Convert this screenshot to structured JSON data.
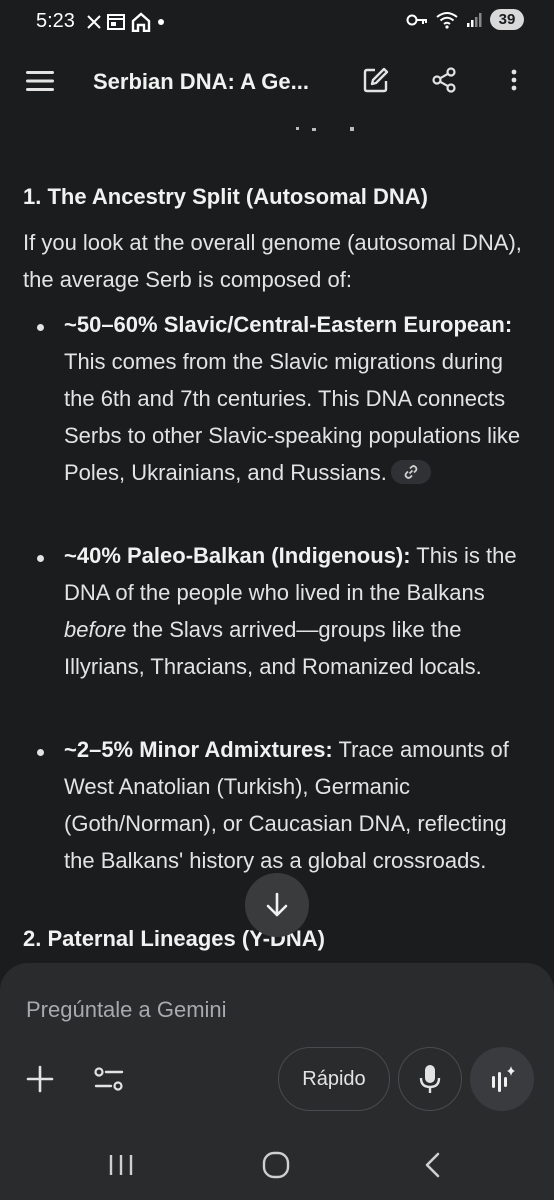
{
  "status_bar": {
    "time": "5:23",
    "battery": "39",
    "icons": [
      "x-icon",
      "calendar-icon",
      "home-icon",
      "dot-icon",
      "key-icon",
      "wifi-icon",
      "signal-icon"
    ]
  },
  "app_bar": {
    "title": "Serbian DNA: A Ge...",
    "icons": [
      "menu-icon",
      "edit-icon",
      "share-icon",
      "more-vert-icon"
    ]
  },
  "content": {
    "section1_heading": "1. The Ancestry Split (Autosomal DNA)",
    "intro": "If you look at the overall genome (autosomal DNA), the average Serb is composed of:",
    "bullets": [
      {
        "bold": "~50–60% Slavic/Central-Eastern European:",
        "text": " This comes from the Slavic migrations during the 6th and 7th centuries. This DNA connects Serbs to other Slavic-speaking populations like Poles, Ukrainians, and Russians."
      },
      {
        "bold": "~40% Paleo-Balkan (Indigenous):",
        "text_before": " This is the DNA of the people who lived in the Balkans ",
        "italic": "before",
        "text_after": " the Slavs arrived—groups like the Illyrians, Thracians, and Romanized locals."
      },
      {
        "bold": "~2–5% Minor Admixtures:",
        "text": " Trace amounts of West Anatolian (Turkish), Germanic (Goth/Norman), or Caucasian DNA, reflecting the Balkans' history as a global crossroads."
      }
    ],
    "section2_heading": "2. Paternal Lineages (Y-DNA)"
  },
  "input_panel": {
    "placeholder": "Pregúntale a Gemini",
    "mode_label": "Rápido"
  },
  "colors": {
    "background": "#1b1c1e",
    "panel": "#2a2b2d",
    "text": "#e3e3e3"
  }
}
